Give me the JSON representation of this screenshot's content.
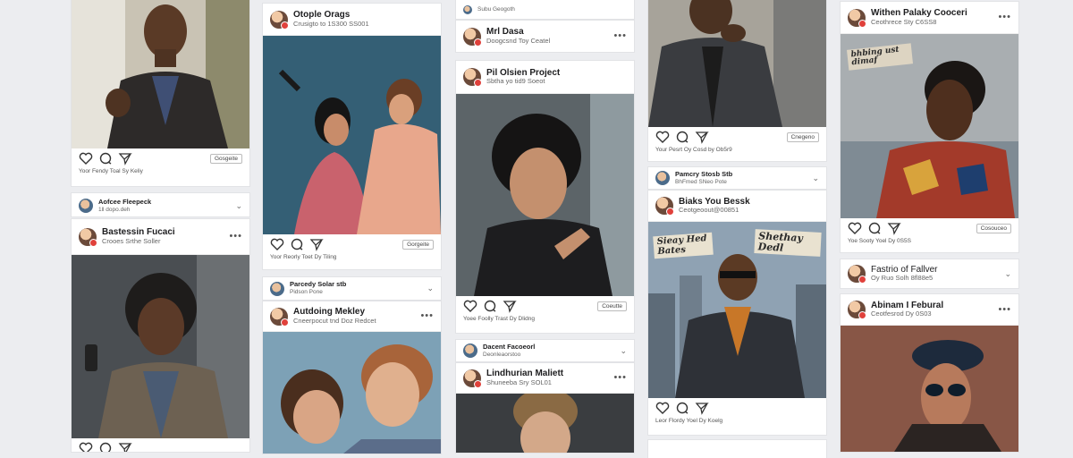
{
  "columns": [
    {
      "cards": [
        {
          "type": "image-post",
          "caption": "Yoor Fendy Toal Sy Keliy",
          "badge": "Gosgeite"
        },
        {
          "type": "group",
          "group_name": "Aofcee Fleepeck",
          "group_sub": "1ll dopo.deh"
        },
        {
          "type": "post",
          "name": "Bastessin Fucaci",
          "sub": "Crooes Srthe Soller"
        }
      ]
    },
    {
      "cards": [
        {
          "type": "post",
          "name": "Otople Orags",
          "sub": "Crusigto to 1S300 SS001",
          "caption": "Yoor Reorly Toet Dy Tiling",
          "badge": "Gorgeite"
        },
        {
          "type": "group",
          "group_name": "Parcedy Solar stb",
          "group_sub": "Pidson Pone"
        },
        {
          "type": "post",
          "name": "Autdoing Mekley",
          "sub": "Cneerpocut tnd Doz Redcet"
        }
      ]
    },
    {
      "cards": [
        {
          "type": "group-top",
          "group_sub": "Subu Geogoth"
        },
        {
          "type": "post-small",
          "name": "Mrl Dasa",
          "sub": "Doogcsnd Toy Ceatel"
        },
        {
          "type": "post",
          "name": "Pil Olsien Project",
          "sub": "Sbtha yo tid9 Soeot",
          "caption": "Yoee Foolly Trast Dy Dlidng",
          "badge": "Coeutte"
        },
        {
          "type": "group",
          "group_name": "Dacent Facoeorl",
          "group_sub": "Deonleaorstoo"
        },
        {
          "type": "post-small",
          "name": "Lindhurian Maliett",
          "sub": "Shuneeba Sry SOL01"
        }
      ]
    },
    {
      "cards": [
        {
          "type": "image-post",
          "caption": "Your Pesrt Oy Cosd by Ob5r9",
          "badge": "Cnegeno"
        },
        {
          "type": "group",
          "group_name": "Pamcry Stosb Stb",
          "group_sub": "BhFmed SNeo Pote"
        },
        {
          "type": "post",
          "name": "Biaks You Bessk",
          "sub": "Ceotgeoout@00851",
          "overlay_left": "Sieay Hed Bates",
          "overlay_right": "Shethay Dedl",
          "caption": "Leor Flordy Yoel Dy Koelg"
        }
      ]
    },
    {
      "cards": [
        {
          "type": "post",
          "name": "Withen Palaky Cooceri",
          "sub": "Ceothrece Sty C6SS8",
          "overlay": "bhbing ust dimaf",
          "caption": "Yoe Sooty Yoel Dy 0S5S",
          "badge": "Cosouceo"
        },
        {
          "type": "group",
          "group_name": "Fastrio of Fallver",
          "group_sub": "Oy Ruo Solh 8fl88e5"
        },
        {
          "type": "post",
          "name": "Abinam I Febural",
          "sub": "Ceotfesrod Dy 0S03"
        }
      ]
    }
  ]
}
